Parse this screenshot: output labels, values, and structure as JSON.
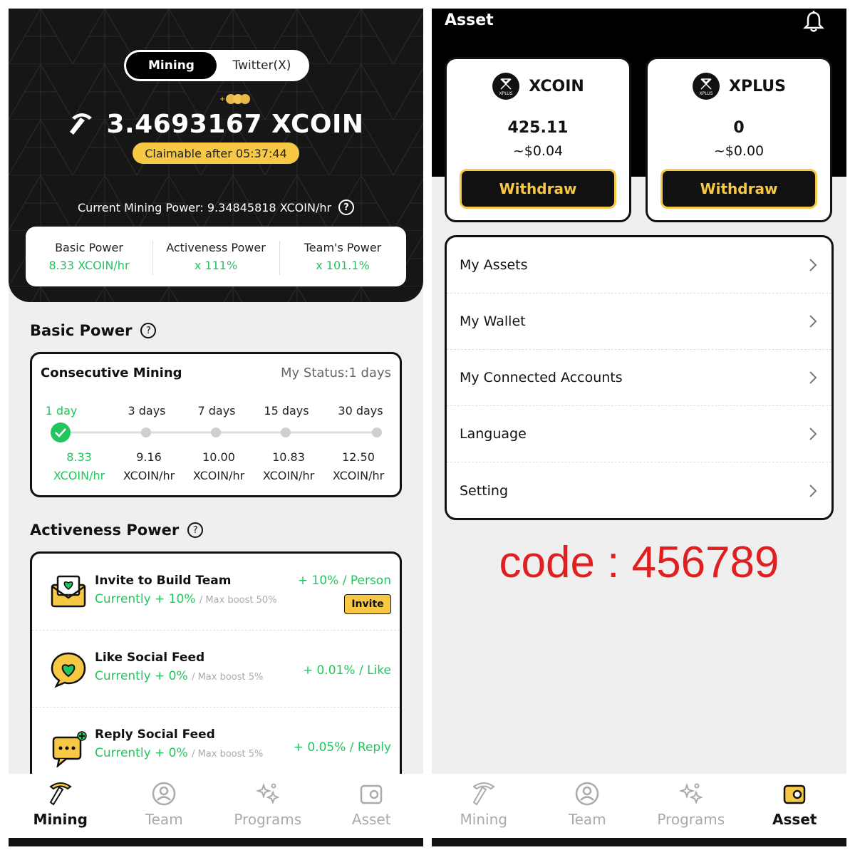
{
  "left": {
    "segment": {
      "mining": "Mining",
      "twitter": "Twitter(X)"
    },
    "amount": "3.4693167 XCOIN",
    "claimable": "Claimable after 05:37:44",
    "current_power": "Current Mining Power: 9.34845818 XCOIN/hr",
    "powers": [
      {
        "label": "Basic Power",
        "value": "8.33 XCOIN/hr"
      },
      {
        "label": "Activeness Power",
        "value": "x 111%"
      },
      {
        "label": "Team's Power",
        "value": "x 101.1%"
      }
    ],
    "basic_power_title": "Basic Power",
    "consecutive": {
      "title": "Consecutive Mining",
      "status": "My Status:1 days",
      "steps": [
        {
          "day": "1 day",
          "rate": "8.33",
          "unit": "XCOIN/hr"
        },
        {
          "day": "3 days",
          "rate": "9.16",
          "unit": "XCOIN/hr"
        },
        {
          "day": "7 days",
          "rate": "10.00",
          "unit": "XCOIN/hr"
        },
        {
          "day": "15 days",
          "rate": "10.83",
          "unit": "XCOIN/hr"
        },
        {
          "day": "30 days",
          "rate": "12.50",
          "unit": "XCOIN/hr"
        }
      ]
    },
    "activeness_title": "Activeness Power",
    "activities": [
      {
        "title": "Invite to Build Team",
        "current": "Currently + 10%",
        "max": "/ Max boost 50%",
        "rate": "+ 10% / Person",
        "button": "Invite"
      },
      {
        "title": "Like Social Feed",
        "current": "Currently + 0%",
        "max": "/ Max boost 5%",
        "rate": "+ 0.01% / Like"
      },
      {
        "title": "Reply Social Feed",
        "current": "Currently + 0%",
        "max": "/ Max boost 5%",
        "rate": "+ 0.05% / Reply"
      }
    ]
  },
  "nav": [
    "Mining",
    "Team",
    "Programs",
    "Asset"
  ],
  "right": {
    "title": "Asset",
    "coins": [
      {
        "name": "XCOIN",
        "balance": "425.11",
        "usd": "~$0.04",
        "withdraw": "Withdraw",
        "logo_text": "XPLUS"
      },
      {
        "name": "XPLUS",
        "balance": "0",
        "usd": "~$0.00",
        "withdraw": "Withdraw",
        "logo_text": "XPLUS"
      }
    ],
    "menu": [
      "My Assets",
      "My Wallet",
      "My Connected Accounts",
      "Language",
      "Setting"
    ],
    "code": "code : 456789"
  },
  "colors": {
    "accent_yellow": "#f6c844",
    "green": "#22c55e",
    "code_red": "#e02020"
  }
}
